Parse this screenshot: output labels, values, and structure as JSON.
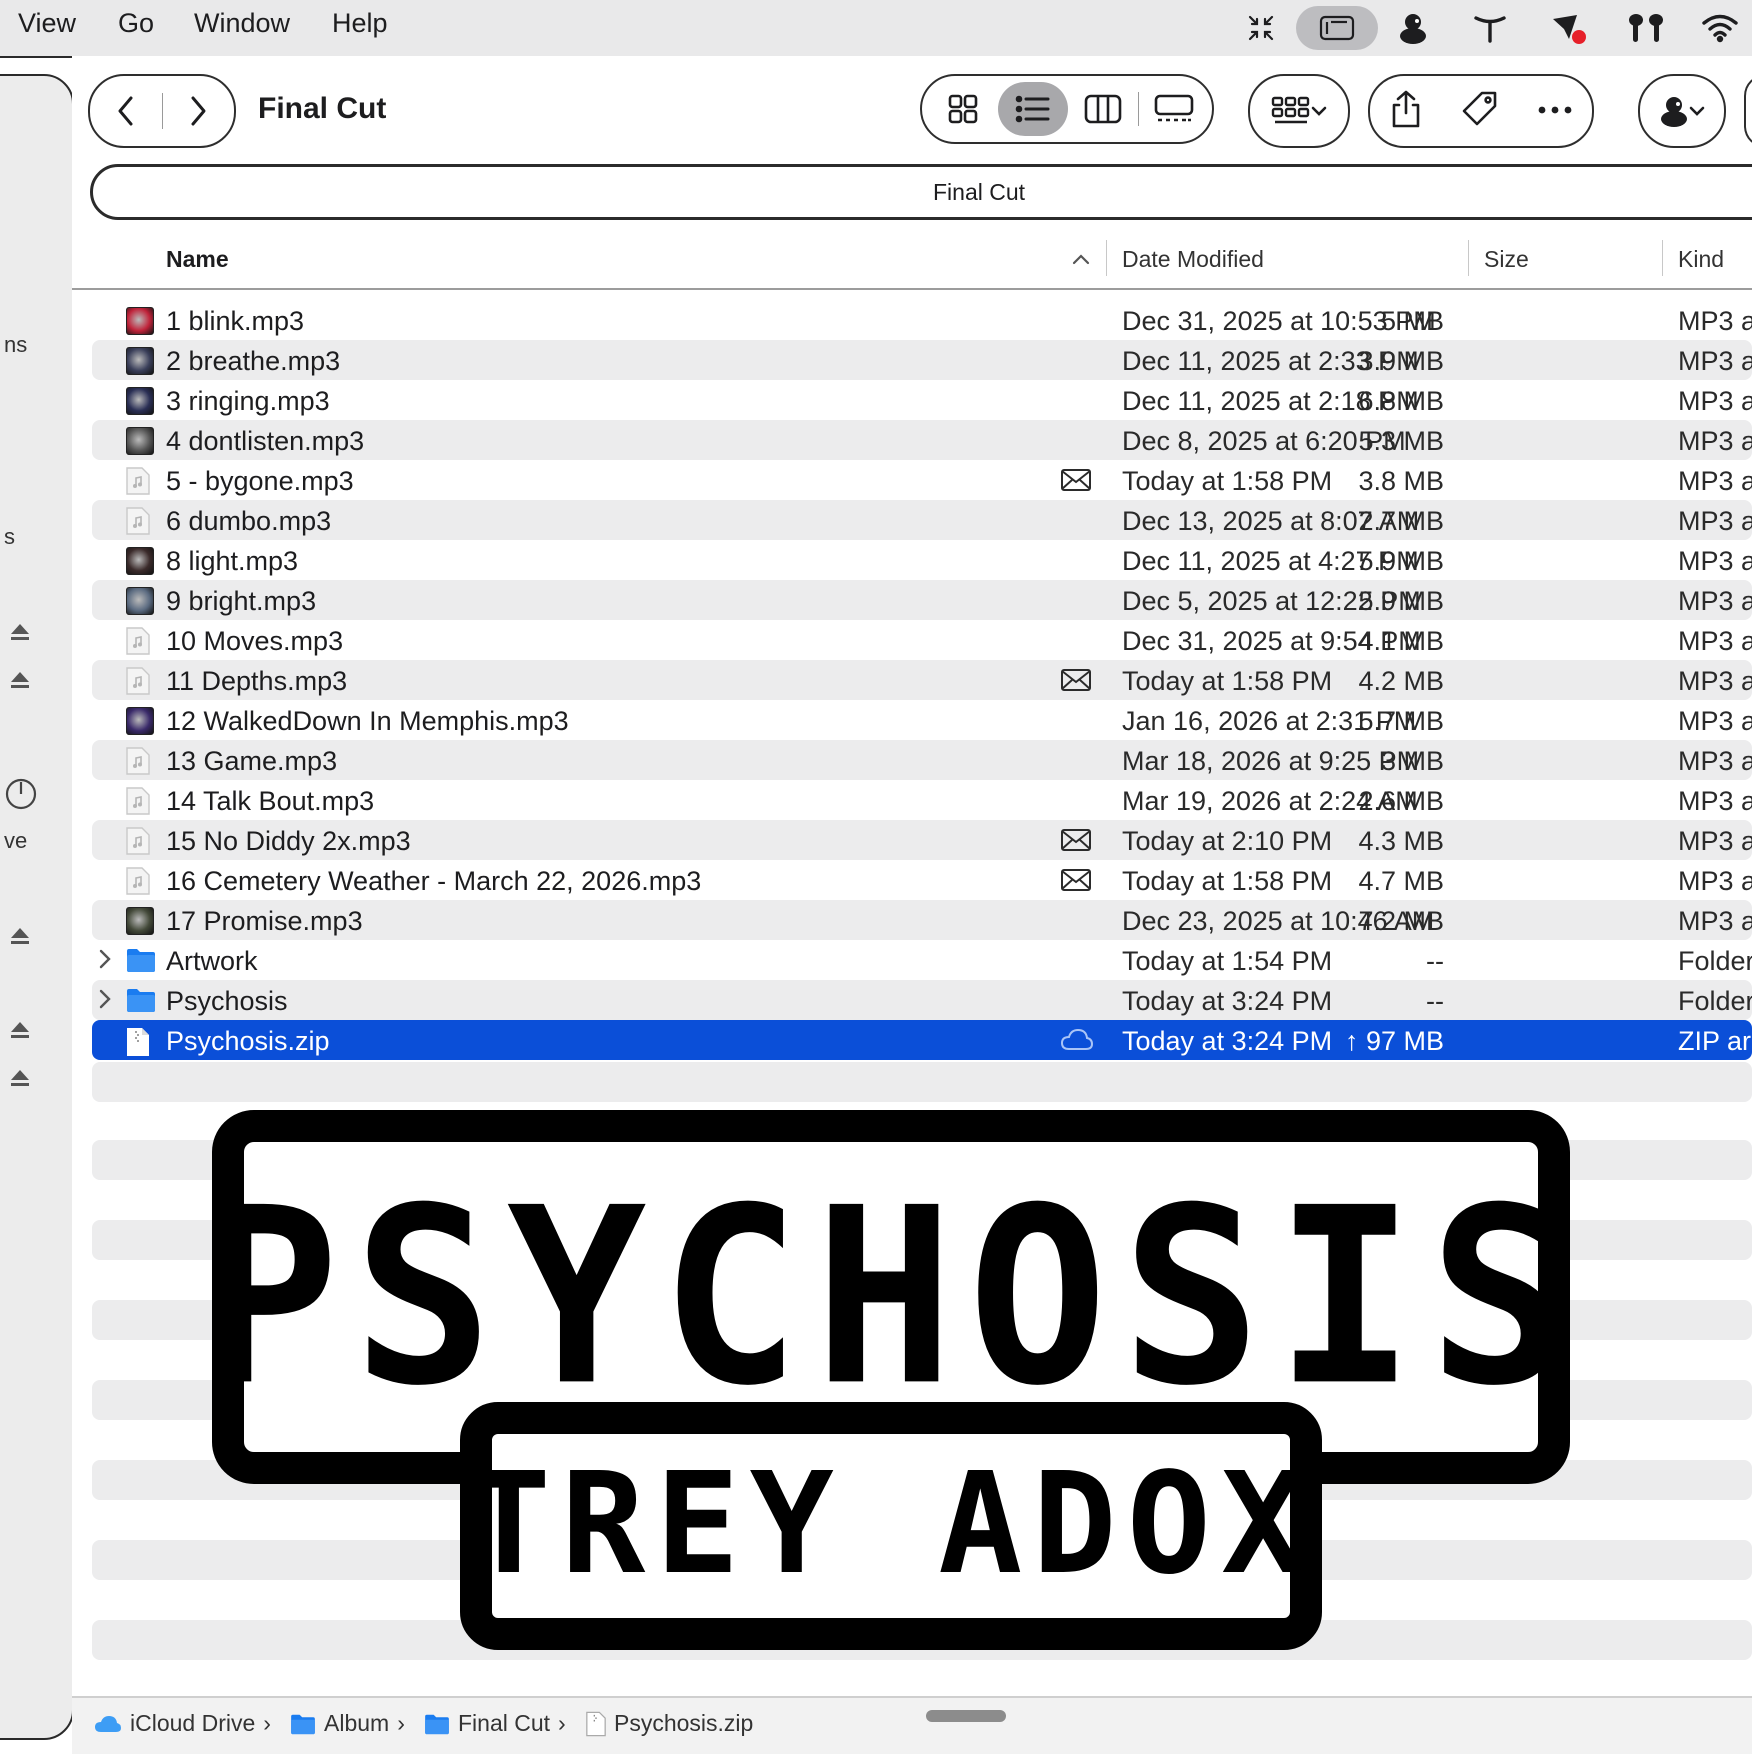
{
  "menubar": {
    "items": [
      "View",
      "Go",
      "Window",
      "Help"
    ],
    "status_icons": [
      "collapse-icon",
      "stage-manager-icon",
      "user-avatar-icon",
      "agent-icon",
      "cursor-badge-icon",
      "airpods-icon",
      "wifi-icon"
    ]
  },
  "window": {
    "title": "Final Cut",
    "path_label": "Final Cut"
  },
  "sidebar": {
    "fragments": [
      "ns",
      "s",
      "ve"
    ]
  },
  "columns": {
    "name": "Name",
    "date": "Date Modified",
    "size": "Size",
    "kind": "Kind"
  },
  "files": [
    {
      "name": "1 blink.mp3",
      "date": "Dec 31, 2025 at 10:53 PM",
      "size": "5 MB",
      "kind": "MP3 a",
      "thumb": "#c0233a",
      "status": ""
    },
    {
      "name": "2 breathe.mp3",
      "date": "Dec 11, 2025 at 2:33 PM",
      "size": "3.9 MB",
      "kind": "MP3 a",
      "thumb": "#3a3f5a",
      "status": ""
    },
    {
      "name": "3 ringing.mp3",
      "date": "Dec 11, 2025 at 2:18 PM",
      "size": "6.8 MB",
      "kind": "MP3 a",
      "thumb": "#2a2f55",
      "status": ""
    },
    {
      "name": "4 dontlisten.mp3",
      "date": "Dec 8, 2025 at 6:20 PM",
      "size": "5.3 MB",
      "kind": "MP3 a",
      "thumb": "#555555",
      "status": ""
    },
    {
      "name": "5 - bygone.mp3",
      "date": "Today at 1:58 PM",
      "size": "3.8 MB",
      "kind": "MP3 a",
      "thumb": "",
      "status": "mail"
    },
    {
      "name": "6 dumbo.mp3",
      "date": "Dec 13, 2025 at 8:07 AM",
      "size": "2.7 MB",
      "kind": "MP3 a",
      "thumb": "",
      "status": ""
    },
    {
      "name": "8 light.mp3",
      "date": "Dec 11, 2025 at 4:27 PM",
      "size": "5.9 MB",
      "kind": "MP3 a",
      "thumb": "#3b2b2b",
      "status": ""
    },
    {
      "name": "9 bright.mp3",
      "date": "Dec 5, 2025 at 12:22 PM",
      "size": "5.9 MB",
      "kind": "MP3 a",
      "thumb": "#5a6a80",
      "status": ""
    },
    {
      "name": "10 Moves.mp3",
      "date": "Dec 31, 2025 at 9:54 PM",
      "size": "4.1 MB",
      "kind": "MP3 a",
      "thumb": "",
      "status": ""
    },
    {
      "name": "11 Depths.mp3",
      "date": "Today at 1:58 PM",
      "size": "4.2 MB",
      "kind": "MP3 a",
      "thumb": "",
      "status": "mail"
    },
    {
      "name": "12 WalkedDown In Memphis.mp3",
      "date": "Jan 16, 2026 at 2:31 PM",
      "size": "5.7 MB",
      "kind": "MP3 a",
      "thumb": "#3a2a6a",
      "status": ""
    },
    {
      "name": "13 Game.mp3",
      "date": "Mar 18, 2026 at 9:25 PM",
      "size": "3 MB",
      "kind": "MP3 a",
      "thumb": "",
      "status": ""
    },
    {
      "name": "14 Talk Bout.mp3",
      "date": "Mar 19, 2026 at 2:24 AM",
      "size": "2.6 MB",
      "kind": "MP3 a",
      "thumb": "",
      "status": ""
    },
    {
      "name": "15 No Diddy 2x.mp3",
      "date": "Today at 2:10 PM",
      "size": "4.3 MB",
      "kind": "MP3 a",
      "thumb": "",
      "status": "mail"
    },
    {
      "name": "16 Cemetery Weather - March 22, 2026.mp3",
      "date": "Today at 1:58 PM",
      "size": "4.7 MB",
      "kind": "MP3 a",
      "thumb": "",
      "status": "mail"
    },
    {
      "name": "17 Promise.mp3",
      "date": "Dec 23, 2025 at 10:46 AM",
      "size": "7.2 MB",
      "kind": "MP3 a",
      "thumb": "#444a3a",
      "status": ""
    }
  ],
  "folders": [
    {
      "name": "Artwork",
      "date": "Today at 1:54 PM",
      "size": "--",
      "kind": "Folder"
    },
    {
      "name": "Psychosis",
      "date": "Today at 3:24 PM",
      "size": "--",
      "kind": "Folder"
    }
  ],
  "selected": {
    "name": "Psychosis.zip",
    "date": "Today at 3:24 PM",
    "size": "↑ 97 MB",
    "kind": "ZIP arc"
  },
  "artwork": {
    "title": "PSYCHOSIS",
    "artist": "TREY ADOX"
  },
  "breadcrumb": [
    "iCloud Drive",
    "Album",
    "Final Cut",
    "Psychosis.zip"
  ],
  "colors": {
    "selection": "#0b4fd8",
    "folder": "#1a7cf0",
    "stripe": "#ececed"
  }
}
